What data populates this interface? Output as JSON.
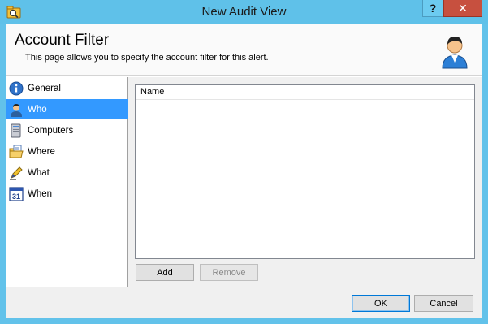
{
  "window": {
    "title": "New Audit View",
    "help_label": "?",
    "close_label": "✕",
    "titlebar_color": "#5fc1e9",
    "close_color": "#c7503f"
  },
  "header": {
    "title": "Account Filter",
    "description": "This page allows you to specify the account filter for this alert.",
    "icon": "user-icon"
  },
  "nav": {
    "selected": "Who",
    "selected_color": "#3399ff",
    "items": [
      {
        "label": "General",
        "icon": "info-icon"
      },
      {
        "label": "Who",
        "icon": "user-icon"
      },
      {
        "label": "Computers",
        "icon": "computer-icon"
      },
      {
        "label": "Where",
        "icon": "folder-icon"
      },
      {
        "label": "What",
        "icon": "pencil-icon"
      },
      {
        "label": "When",
        "icon": "calendar-icon"
      }
    ]
  },
  "list": {
    "columns": [
      "Name",
      ""
    ],
    "rows": []
  },
  "buttons": {
    "add": "Add",
    "remove": "Remove",
    "ok": "OK",
    "cancel": "Cancel"
  },
  "calendar_icon_text": "31"
}
